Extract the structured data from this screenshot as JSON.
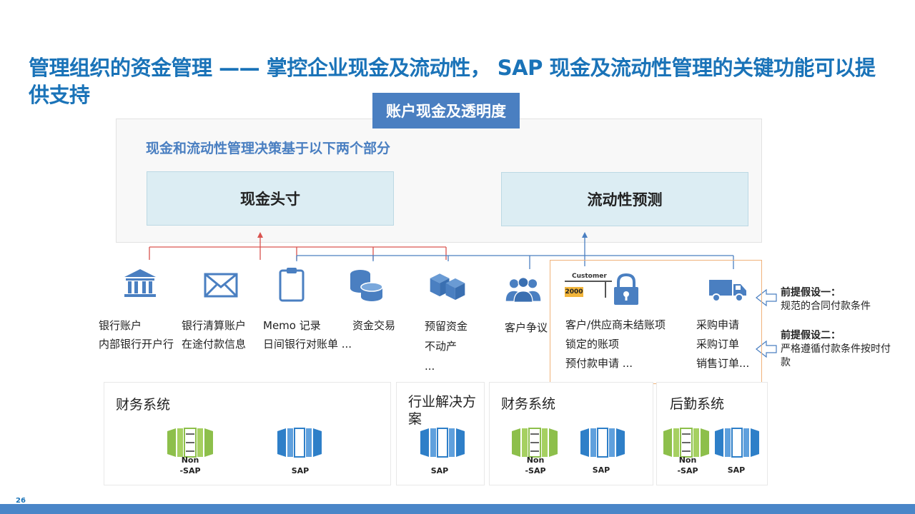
{
  "title": "管理组织的资金管理 —— 掌控企业现金及流动性，  SAP 现金及流动性管理的关键功能可以提供支持",
  "tag": "账户现金及透明度",
  "panel": {
    "subtitle": "现金和流动性管理决策基于以下两个部分",
    "left_box": "现金头寸",
    "right_box": "流动性预测"
  },
  "sources": [
    {
      "icon": "bank-icon",
      "lines": [
        "银行账户",
        "内部银行开户行"
      ]
    },
    {
      "icon": "envelope-icon",
      "lines": [
        "银行清算账户",
        "在途付款信息"
      ]
    },
    {
      "icon": "clipboard-icon",
      "lines": [
        "Memo 记录",
        "日间银行对账单 ..."
      ]
    },
    {
      "icon": "coins-icon",
      "lines": [
        "资金交易"
      ]
    },
    {
      "icon": "boxes-icon",
      "lines": [
        "预留资金",
        "不动产",
        "..."
      ]
    },
    {
      "icon": "users-icon",
      "lines": [
        "客户争议"
      ]
    },
    {
      "icon": "lock-icon",
      "lines": [
        "客户/供应商未结账项",
        "锁定的账项",
        "预付款申请 ..."
      ]
    },
    {
      "icon": "truck-icon",
      "lines": [
        "采购申请",
        "采购订单",
        "销售订单..."
      ]
    }
  ],
  "customer_card": {
    "label": "Customer",
    "value": "2000"
  },
  "premises": [
    {
      "title": "前提假设一：",
      "text": "规范的合同付款条件"
    },
    {
      "title": "前提假设二：",
      "text": "严格遵循付款条件按时付款"
    }
  ],
  "systems": [
    {
      "name": "财务系统",
      "servers": [
        "Non-SAP",
        "SAP"
      ]
    },
    {
      "name": "行业解决方案",
      "servers": [
        "SAP"
      ]
    },
    {
      "name": "财务系统",
      "servers": [
        "Non-SAP",
        "SAP"
      ]
    },
    {
      "name": "后勤系统",
      "servers": [
        "Non-SAP",
        "SAP"
      ]
    }
  ],
  "server_labels": {
    "non_sap_1": "Non",
    "non_sap_2": "-SAP",
    "sap": "SAP"
  },
  "page_number": "26",
  "colors": {
    "title": "#1a73b8",
    "accent": "#4a7fc1",
    "red_line": "#d9534f",
    "blue_line": "#4a7fc1",
    "green_server": "#8dbf4b",
    "blue_server": "#2e7fc8"
  }
}
